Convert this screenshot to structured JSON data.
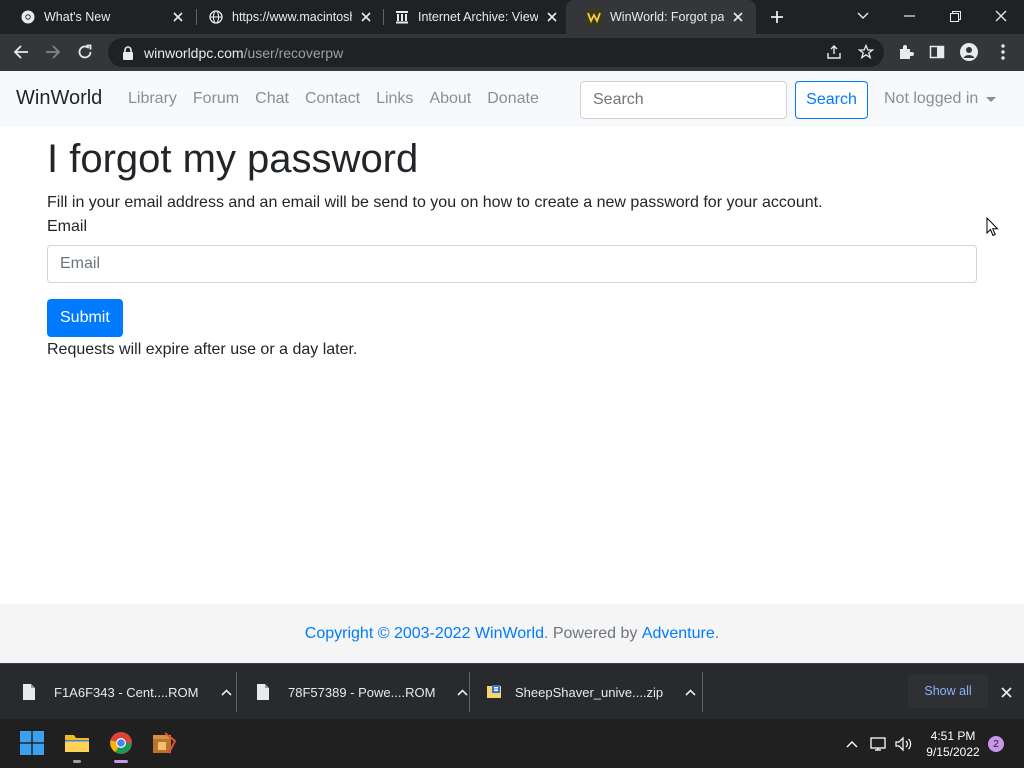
{
  "browser": {
    "tabs": [
      {
        "title": "What's New",
        "icon": "chrome-icon",
        "active": false
      },
      {
        "title": "https://www.macintosh",
        "icon": "globe-icon",
        "active": false
      },
      {
        "title": "Internet Archive: View",
        "icon": "archive-icon",
        "active": false
      },
      {
        "title": "WinWorld: Forgot pass",
        "icon": "winworld-icon",
        "active": true
      }
    ],
    "url_host": "winworldpc.com",
    "url_path": "/user/recoverpw"
  },
  "site": {
    "brand": "WinWorld",
    "nav": [
      "Library",
      "Forum",
      "Chat",
      "Contact",
      "Links",
      "About",
      "Donate"
    ],
    "search_placeholder": "Search",
    "search_button": "Search",
    "user_menu": "Not logged in"
  },
  "main": {
    "heading": "I forgot my password",
    "intro": "Fill in your email address and an email will be send to you on how to create a new password for your account.",
    "email_label": "Email",
    "email_placeholder": "Email",
    "submit_label": "Submit",
    "note": "Requests will expire after use or a day later."
  },
  "footer": {
    "copyright": "Copyright © 2003-2022 WinWorld",
    "powered_by": "Powered by",
    "powered_link": "Adventure"
  },
  "downloads": {
    "items": [
      {
        "name": "F1A6F343 - Cent....ROM",
        "icon": "file-icon"
      },
      {
        "name": "78F57389 - Powe....ROM",
        "icon": "file-icon"
      },
      {
        "name": "SheepShaver_unive....zip",
        "icon": "zip-icon"
      }
    ],
    "show_all": "Show all"
  },
  "taskbar": {
    "time": "4:51 PM",
    "date": "9/15/2022",
    "notifications": "2"
  },
  "colors": {
    "primary": "#007bff",
    "navbar_bg": "#f8f9fa",
    "browser_dark": "#202124",
    "toolbar": "#35363a"
  }
}
